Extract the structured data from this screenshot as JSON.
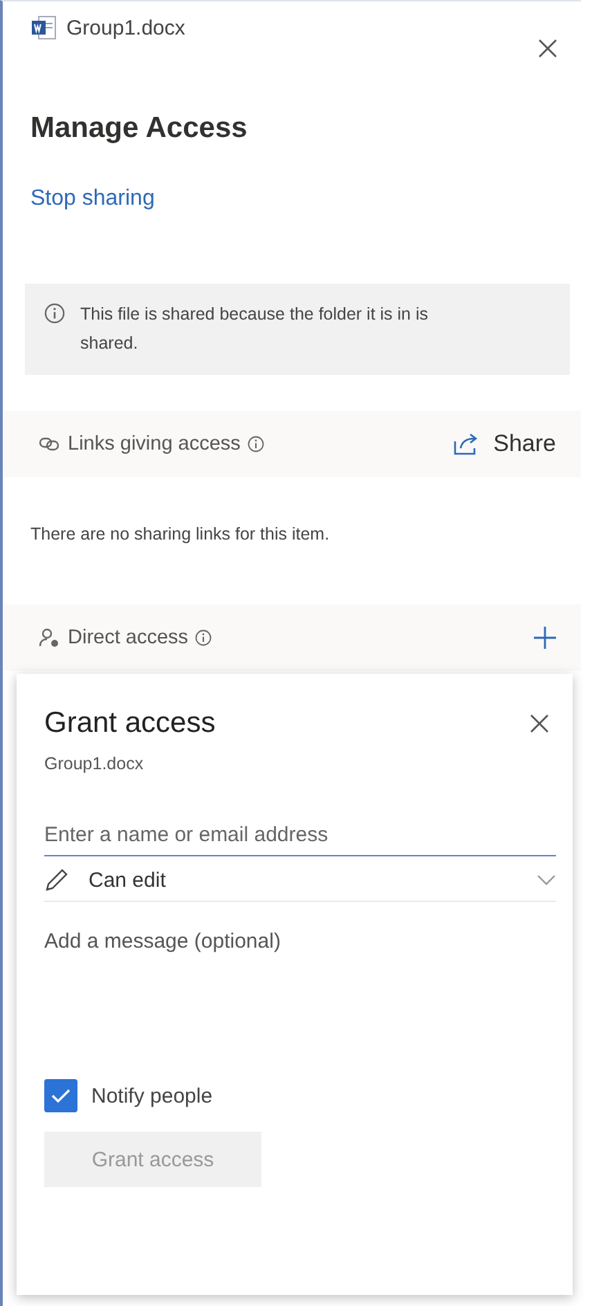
{
  "header": {
    "file_name": "Group1.docx"
  },
  "title": "Manage Access",
  "stop_sharing": "Stop sharing",
  "info_banner": "This file is shared because the folder it is in is shared.",
  "links_section": {
    "label": "Links giving access",
    "action": "Share",
    "empty_text": "There are no sharing links for this item."
  },
  "direct_section": {
    "label": "Direct access"
  },
  "grant_panel": {
    "title": "Grant access",
    "file_name": "Group1.docx",
    "name_field": {
      "placeholder": "Enter a name or email address"
    },
    "permission": {
      "value": "Can edit"
    },
    "message_field": {
      "placeholder": "Add a message (optional)"
    },
    "notify": {
      "label": "Notify people",
      "checked": true
    },
    "submit": {
      "label": "Grant access",
      "disabled": true
    }
  }
}
